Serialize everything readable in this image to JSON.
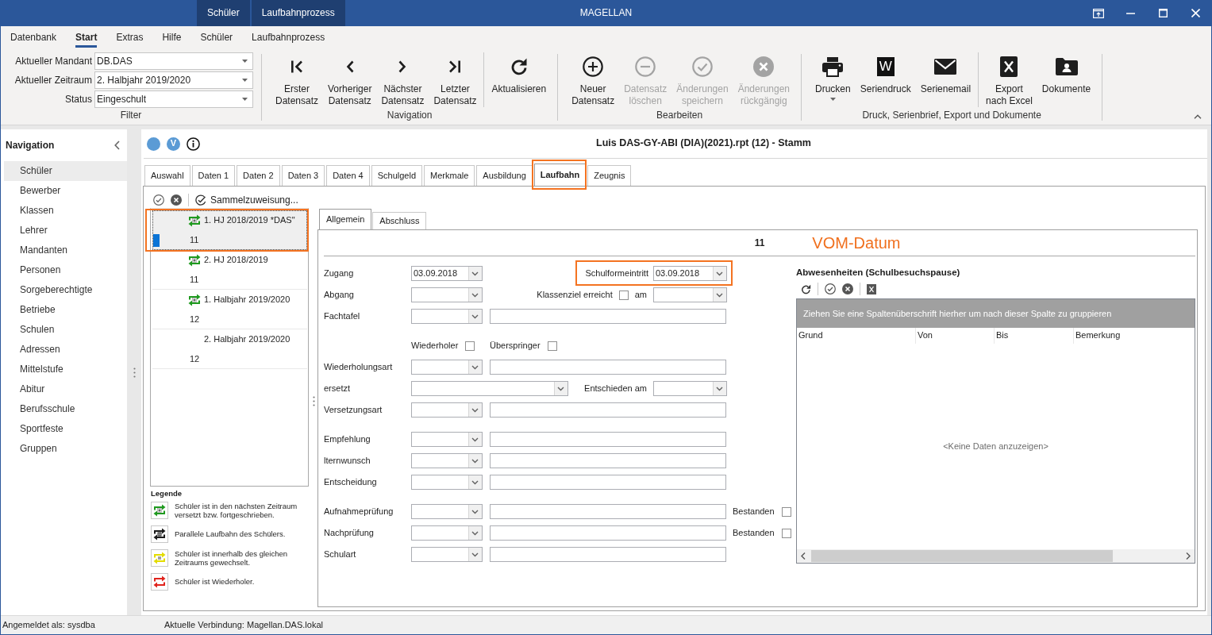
{
  "window": {
    "title": "MAGELLAN",
    "context_tabs": [
      "Schüler",
      "Laufbahnprozess"
    ]
  },
  "ribbon": {
    "tabs": [
      {
        "label": "Datenbank",
        "selected": false
      },
      {
        "label": "Start",
        "selected": true
      },
      {
        "label": "Extras",
        "selected": false
      },
      {
        "label": "Hilfe",
        "selected": false
      },
      {
        "label": "Schüler",
        "selected": false
      },
      {
        "label": "Laufbahnprozess",
        "selected": false
      }
    ],
    "filter": {
      "label": "Filter",
      "fields": [
        {
          "label": "Aktueller Mandant",
          "value": "DB.DAS"
        },
        {
          "label": "Aktueller Zeitraum",
          "value": "2. Halbjahr 2019/2020"
        },
        {
          "label": "Status",
          "value": "Eingeschult"
        }
      ]
    },
    "groups": [
      {
        "label": "Navigation",
        "sections": [
          [
            {
              "kind": "first",
              "label": "Erster\nDatensatz",
              "disabled": false,
              "dropdown": false
            },
            {
              "kind": "previous",
              "label": "Vorheriger\nDatensatz",
              "disabled": false,
              "dropdown": false
            },
            {
              "kind": "next",
              "label": "Nächster\nDatensatz",
              "disabled": false,
              "dropdown": false
            },
            {
              "kind": "last",
              "label": "Letzter\nDatensatz",
              "disabled": false,
              "dropdown": false
            }
          ],
          [
            {
              "kind": "refresh",
              "label": "Aktualisieren",
              "disabled": false,
              "dropdown": false
            }
          ]
        ]
      },
      {
        "label": "Bearbeiten",
        "sections": [
          [
            {
              "kind": "new",
              "label": "Neuer\nDatensatz",
              "disabled": false,
              "dropdown": false
            },
            {
              "kind": "delete",
              "label": "Datensatz\nlöschen",
              "disabled": true,
              "dropdown": false
            },
            {
              "kind": "save",
              "label": "Änderungen\nspeichern",
              "disabled": true,
              "dropdown": false
            },
            {
              "kind": "undo",
              "label": "Änderungen\nrückgängig",
              "disabled": true,
              "dropdown": false
            }
          ]
        ]
      },
      {
        "label": "Druck, Serienbrief, Export und Dokumente",
        "sections": [
          [
            {
              "kind": "print",
              "label": "Drucken",
              "disabled": false,
              "dropdown": true
            },
            {
              "kind": "serial-print",
              "glyph": "W",
              "label": "Seriendruck",
              "disabled": false,
              "dropdown": false
            },
            {
              "kind": "email",
              "label": "Serienemail",
              "disabled": false,
              "dropdown": false
            }
          ],
          [
            {
              "kind": "excel",
              "label": "Export\nnach Excel",
              "disabled": false,
              "dropdown": false
            },
            {
              "kind": "documents",
              "label": "Dokumente",
              "disabled": false,
              "dropdown": false
            }
          ]
        ]
      }
    ]
  },
  "navigation": {
    "title": "Navigation",
    "items": [
      {
        "label": "Schüler",
        "selected": true
      },
      {
        "label": "Bewerber",
        "selected": false
      },
      {
        "label": "Klassen",
        "selected": false
      },
      {
        "label": "Lehrer",
        "selected": false
      },
      {
        "label": "Mandanten",
        "selected": false
      },
      {
        "label": "Personen",
        "selected": false
      },
      {
        "label": "Sorgeberechtigte",
        "selected": false
      },
      {
        "label": "Betriebe",
        "selected": false
      },
      {
        "label": "Schulen",
        "selected": false
      },
      {
        "label": "Adressen",
        "selected": false
      },
      {
        "label": "Mittelstufe",
        "selected": false
      },
      {
        "label": "Abitur",
        "selected": false
      },
      {
        "label": "Berufsschule",
        "selected": false
      },
      {
        "label": "Sportfeste",
        "selected": false
      },
      {
        "label": "Gruppen",
        "selected": false
      }
    ]
  },
  "record": {
    "badge": "V",
    "title": "Luis DAS-GY-ABI (DIA)(2021).rpt (12) - Stamm",
    "tabs": [
      {
        "label": "Auswahl",
        "selected": false,
        "highlighted": false
      },
      {
        "label": "Daten 1",
        "selected": false,
        "highlighted": false
      },
      {
        "label": "Daten 2",
        "selected": false,
        "highlighted": false
      },
      {
        "label": "Daten 3",
        "selected": false,
        "highlighted": false
      },
      {
        "label": "Daten 4",
        "selected": false,
        "highlighted": false
      },
      {
        "label": "Schulgeld",
        "selected": false,
        "highlighted": false
      },
      {
        "label": "Merkmale",
        "selected": false,
        "highlighted": false
      },
      {
        "label": "Ausbildung",
        "selected": false,
        "highlighted": false
      },
      {
        "label": "Laufbahn",
        "selected": true,
        "highlighted": true
      },
      {
        "label": "Zeugnis",
        "selected": false,
        "highlighted": false
      }
    ]
  },
  "career": {
    "action": "Sammelzuweisung...",
    "entries": [
      {
        "kind": "promoted",
        "title": "1. HJ 2018/2019 *DAS\"",
        "grade": "11",
        "selected": true,
        "current": true,
        "highlighted": true
      },
      {
        "kind": "promoted",
        "title": "2. HJ 2018/2019",
        "grade": "11",
        "selected": false,
        "current": false,
        "highlighted": false
      },
      {
        "kind": "promoted",
        "title": "1. Halbjahr 2019/2020",
        "grade": "12",
        "selected": false,
        "current": false,
        "highlighted": false
      },
      {
        "kind": "none",
        "title": "2. Halbjahr 2019/2020",
        "grade": "12",
        "selected": false,
        "current": false,
        "highlighted": false
      }
    ],
    "legend": {
      "title": "Legende",
      "items": [
        {
          "kind": "promoted",
          "text": "Schüler ist in den nächsten Zeitraum\nversetzt bzw. fortgeschrieben."
        },
        {
          "kind": "parallel",
          "text": "Parallele Laufbahn des Schülers."
        },
        {
          "kind": "switched",
          "text": "Schüler ist innerhalb des gleichen\nZeitraums gewechselt."
        },
        {
          "kind": "repeater",
          "text": "Schüler ist Wiederholer."
        }
      ]
    }
  },
  "form": {
    "tabs": [
      {
        "label": "Allgemein",
        "selected": true
      },
      {
        "label": "Abschluss",
        "selected": false
      }
    ],
    "grade": "11",
    "annotation": "VOM-Datum",
    "sections": [
      [
        {
          "kind": "date-pair",
          "label": "Zugang",
          "value": "03.09.2018",
          "side_label": "Schulformeintritt",
          "side_value": "03.09.2018",
          "highlighted": true
        },
        {
          "kind": "goal",
          "label": "Abgang",
          "side_label": "Klassenziel erreicht",
          "checked": false,
          "date_label": "am"
        },
        {
          "kind": "combo-text",
          "label": "Fachtafel"
        }
      ],
      [
        {
          "kind": "checks",
          "items": [
            {
              "label": "Wiederholer",
              "checked": false
            },
            {
              "label": "Überspringer",
              "checked": false
            }
          ]
        },
        {
          "kind": "combo-text",
          "label": "Wiederholungsart"
        },
        {
          "kind": "decision",
          "label": "ersetzt",
          "side_label": "Entschieden am"
        },
        {
          "kind": "combo-text",
          "label": "Versetzungsart"
        }
      ],
      [
        {
          "kind": "combo-text",
          "label": "Empfehlung"
        },
        {
          "kind": "combo-text",
          "label": "lternwunsch"
        },
        {
          "kind": "combo-text",
          "label": "Entscheidung"
        }
      ],
      [
        {
          "kind": "combo-text",
          "label": "Aufnahmeprüfung",
          "check_label": "Bestanden",
          "checked": false
        },
        {
          "kind": "combo-text",
          "label": "Nachprüfung",
          "check_label": "Bestanden",
          "checked": false
        },
        {
          "kind": "combo-text",
          "label": "Schulart"
        }
      ]
    ]
  },
  "absences": {
    "title": "Abwesenheiten (Schulbesuchspause)",
    "group_hint": "Ziehen Sie eine Spaltenüberschrift hierher um nach dieser Spalte zu gruppieren",
    "columns": [
      "Grund",
      "Von",
      "Bis",
      "Bemerkung"
    ],
    "empty_text": "<Keine Daten anzuzeigen>"
  },
  "status_bar": {
    "user": "Angemeldet als: sysdba",
    "connection": "Aktuelle Verbindung: Magellan.DAS.lokal"
  }
}
